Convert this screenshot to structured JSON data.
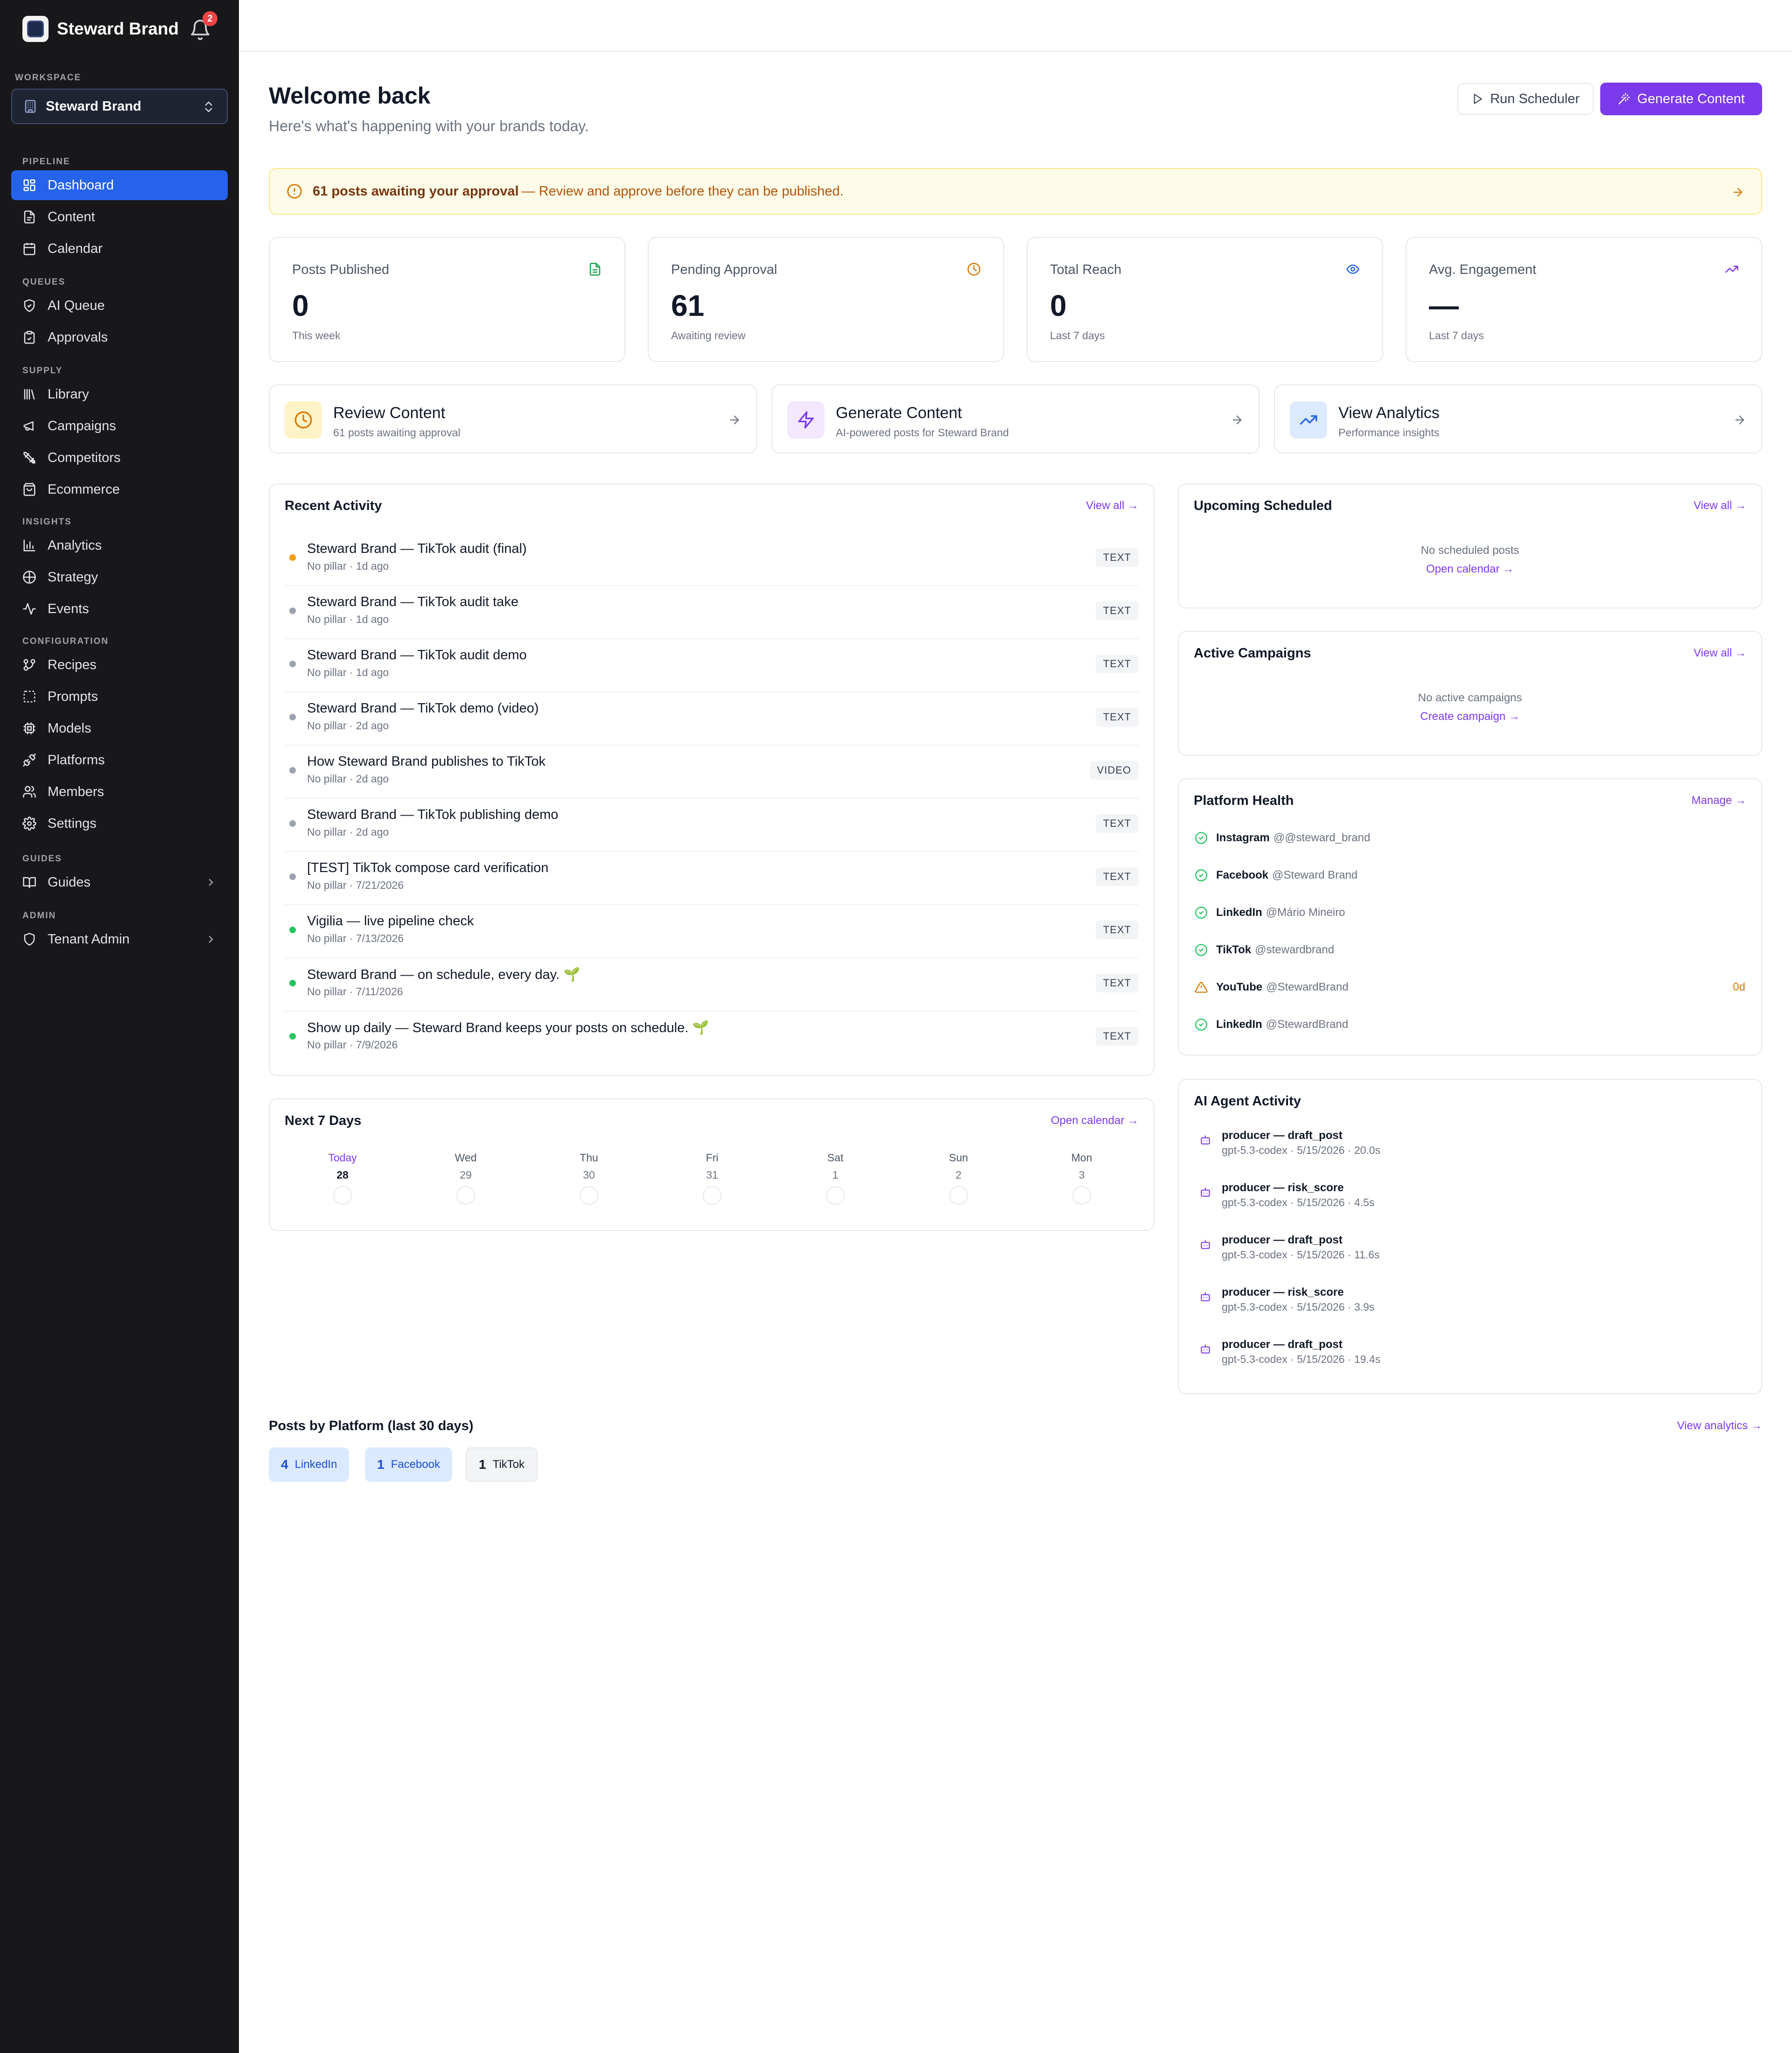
{
  "sidebar": {
    "brand_name": "Steward Brand",
    "notification_count": "2",
    "workspace_label": "WORKSPACE",
    "workspace_value": "Steward Brand",
    "sections": {
      "pipeline": "PIPELINE",
      "queues": "QUEUES",
      "supply": "SUPPLY",
      "insights": "INSIGHTS",
      "configuration": "CONFIGURATION",
      "guides": "GUIDES",
      "admin": "ADMIN"
    },
    "items": {
      "dashboard": "Dashboard",
      "content": "Content",
      "calendar": "Calendar",
      "ai_queue": "AI Queue",
      "approvals": "Approvals",
      "library": "Library",
      "campaigns": "Campaigns",
      "competitors": "Competitors",
      "ecommerce": "Ecommerce",
      "analytics": "Analytics",
      "strategy": "Strategy",
      "events": "Events",
      "recipes": "Recipes",
      "prompts": "Prompts",
      "models": "Models",
      "platforms": "Platforms",
      "members": "Members",
      "settings": "Settings",
      "guides": "Guides",
      "tenant_admin": "Tenant Admin"
    }
  },
  "header": {
    "title": "Welcome back",
    "subtitle": "Here's what's happening with your brands today.",
    "run_scheduler": "Run Scheduler",
    "generate_content": "Generate Content"
  },
  "alert": {
    "strong": "61 posts awaiting your approval",
    "rest": "— Review and approve before they can be published."
  },
  "stats": [
    {
      "label": "Posts Published",
      "value": "0",
      "sub": "This week",
      "icon": "document-icon"
    },
    {
      "label": "Pending Approval",
      "value": "61",
      "sub": "Awaiting review",
      "icon": "clock-icon"
    },
    {
      "label": "Total Reach",
      "value": "0",
      "sub": "Last 7 days",
      "icon": "eye-icon"
    },
    {
      "label": "Avg. Engagement",
      "value": "—",
      "sub": "Last 7 days",
      "icon": "trend-up-icon"
    }
  ],
  "quick_actions": [
    {
      "title": "Review Content",
      "sub": "61 posts awaiting approval"
    },
    {
      "title": "Generate Content",
      "sub": "AI-powered posts for Steward Brand"
    },
    {
      "title": "View Analytics",
      "sub": "Performance insights"
    }
  ],
  "recent_activity": {
    "title": "Recent Activity",
    "view_all": "View all →",
    "items": [
      {
        "title": "Steward Brand — TikTok audit (final)",
        "meta": "No pillar · 1d ago",
        "badge": "TEXT",
        "status_color": "#f59e0b"
      },
      {
        "title": "Steward Brand — TikTok audit take",
        "meta": "No pillar · 1d ago",
        "badge": "TEXT",
        "status_color": "#9ca3af"
      },
      {
        "title": "Steward Brand — TikTok audit demo",
        "meta": "No pillar · 1d ago",
        "badge": "TEXT",
        "status_color": "#9ca3af"
      },
      {
        "title": "Steward Brand — TikTok demo (video)",
        "meta": "No pillar · 2d ago",
        "badge": "TEXT",
        "status_color": "#9ca3af"
      },
      {
        "title": "How Steward Brand publishes to TikTok",
        "meta": "No pillar · 2d ago",
        "badge": "VIDEO",
        "status_color": "#9ca3af"
      },
      {
        "title": "Steward Brand — TikTok publishing demo",
        "meta": "No pillar · 2d ago",
        "badge": "TEXT",
        "status_color": "#9ca3af"
      },
      {
        "title": "[TEST] TikTok compose card verification",
        "meta": "No pillar · 7/21/2026",
        "badge": "TEXT",
        "status_color": "#9ca3af"
      },
      {
        "title": "Vigilia — live pipeline check",
        "meta": "No pillar · 7/13/2026",
        "badge": "TEXT",
        "status_color": "#22c55e"
      },
      {
        "title": "Steward Brand — on schedule, every day. 🌱",
        "meta": "No pillar · 7/11/2026",
        "badge": "TEXT",
        "status_color": "#22c55e"
      },
      {
        "title": "Show up daily — Steward Brand keeps your posts on schedule. 🌱",
        "meta": "No pillar · 7/9/2026",
        "badge": "TEXT",
        "status_color": "#22c55e"
      }
    ]
  },
  "next7": {
    "title": "Next 7 Days",
    "link": "Open calendar →",
    "days": [
      {
        "name": "Today",
        "num": "28"
      },
      {
        "name": "Wed",
        "num": "29"
      },
      {
        "name": "Thu",
        "num": "30"
      },
      {
        "name": "Fri",
        "num": "31"
      },
      {
        "name": "Sat",
        "num": "1"
      },
      {
        "name": "Sun",
        "num": "2"
      },
      {
        "name": "Mon",
        "num": "3"
      }
    ]
  },
  "upcoming": {
    "title": "Upcoming Scheduled",
    "link": "View all →",
    "empty": "No scheduled posts",
    "action": "Open calendar →"
  },
  "campaigns": {
    "title": "Active Campaigns",
    "link": "View all →",
    "empty": "No active campaigns",
    "action": "Create campaign →"
  },
  "platform_health": {
    "title": "Platform Health",
    "link": "Manage →",
    "items": [
      {
        "name": "Instagram",
        "handle": "@@steward_brand",
        "status": "ok",
        "extra": ""
      },
      {
        "name": "Facebook",
        "handle": "@Steward Brand",
        "status": "ok",
        "extra": ""
      },
      {
        "name": "LinkedIn",
        "handle": "@Mário Mineiro",
        "status": "ok",
        "extra": ""
      },
      {
        "name": "TikTok",
        "handle": "@stewardbrand",
        "status": "ok",
        "extra": ""
      },
      {
        "name": "YouTube",
        "handle": "@StewardBrand",
        "status": "warning",
        "extra": "0d"
      },
      {
        "name": "LinkedIn",
        "handle": "@StewardBrand",
        "status": "ok",
        "extra": ""
      }
    ]
  },
  "ai_activity": {
    "title": "AI Agent Activity",
    "items": [
      {
        "title": "producer — draft_post",
        "meta": "gpt-5.3-codex · 5/15/2026 · 20.0s"
      },
      {
        "title": "producer — risk_score",
        "meta": "gpt-5.3-codex · 5/15/2026 · 4.5s"
      },
      {
        "title": "producer — draft_post",
        "meta": "gpt-5.3-codex · 5/15/2026 · 11.6s"
      },
      {
        "title": "producer — risk_score",
        "meta": "gpt-5.3-codex · 5/15/2026 · 3.9s"
      },
      {
        "title": "producer — draft_post",
        "meta": "gpt-5.3-codex · 5/15/2026 · 19.4s"
      }
    ]
  },
  "posts_by_platform": {
    "title": "Posts by Platform (last 30 days)",
    "link": "View analytics →",
    "chips": [
      {
        "count": "4",
        "label": "LinkedIn"
      },
      {
        "count": "1",
        "label": "Facebook"
      },
      {
        "count": "1",
        "label": "TikTok"
      }
    ]
  },
  "colors": {
    "sidebar_bg": "#18181b",
    "active_nav": "#2563eb",
    "accent": "#7c3aed",
    "warning": "#f59e0b",
    "success": "#22c55e"
  }
}
